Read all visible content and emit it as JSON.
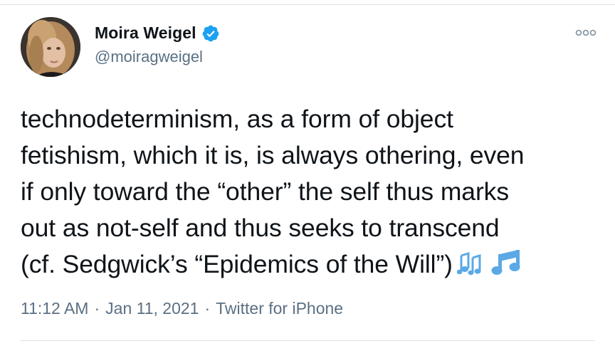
{
  "author": {
    "display_name": "Moira Weigel",
    "handle": "@moiragweigel",
    "verified": true
  },
  "tweet": {
    "text": "technodeterminism, as a form of object\nfetishism, which it is, is always othering, even\nif only toward the “other” the self thus marks\nout as not-self and thus seeks to transcend\n(cf. Sedgwick’s “Epidemics of the Will”)",
    "emoji": [
      "multiple-musical-notes-icon",
      "musical-note-icon"
    ]
  },
  "meta": {
    "time": "11:12 AM",
    "date": "Jan 11, 2021",
    "separator": "·",
    "source": "Twitter for iPhone"
  },
  "colors": {
    "verified_blue": "#1da1f2",
    "secondary_text": "#5b7083",
    "primary_text": "#0f1419",
    "emoji_blue": "#5aa9e6"
  },
  "icons": {
    "more": "more-options-icon",
    "verified": "verified-badge-icon"
  }
}
